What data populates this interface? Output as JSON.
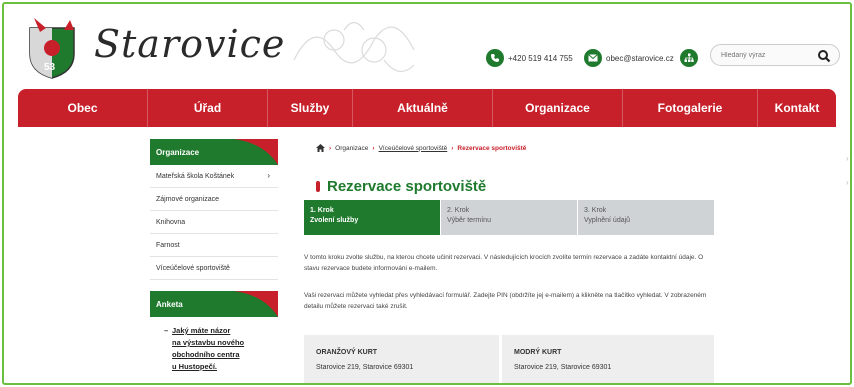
{
  "site": {
    "name": "Starovice"
  },
  "header": {
    "phone": "+420 519 414 755",
    "email": "obec@starovice.cz",
    "search_placeholder": "Hledaný výraz"
  },
  "nav": [
    "Obec",
    "Úřad",
    "Služby",
    "Aktuálně",
    "Organizace",
    "Fotogalerie",
    "Kontakt"
  ],
  "sidebar": {
    "section_title": "Organizace",
    "items": [
      {
        "label": "Mateřská škola Koštánek"
      },
      {
        "label": "Zájmové organizace"
      },
      {
        "label": "Knihovna"
      },
      {
        "label": "Farnost"
      },
      {
        "label": "Víceúčelové sportoviště"
      }
    ],
    "poll_title": "Anketa",
    "poll_question": [
      "Jaký máte názor",
      "na výstavbu nového",
      "obchodního centra",
      "u Hustopečí."
    ]
  },
  "breadcrumb": {
    "home": "home-icon",
    "items": [
      "Organizace",
      "Víceúčelové sportoviště"
    ],
    "current": "Rezervace sportoviště"
  },
  "page": {
    "title": "Rezervace sportoviště",
    "steps": [
      {
        "label": "1. Krok",
        "desc": "Zvolení služby",
        "active": true
      },
      {
        "label": "2. Krok",
        "desc": "Výběr termínu",
        "active": false
      },
      {
        "label": "3. Krok",
        "desc": "Vyplnění údajů",
        "active": false
      }
    ],
    "para1": "V tomto kroku zvolte službu, na kterou chcete učinit rezervaci. V následujících krocích zvolíte termín rezervace a zadáte kontaktní údaje. O stavu rezervace budete informováni e-mailem.",
    "para2": "Vaši rezervaci můžete vyhledat přes vyhledávací formulář. Zadejte PIN (obdržíte jej e-mailem) a klikněte na tlačítko vyhledat. V zobrazeném detailu můžete rezervaci také zrušit.",
    "cards": [
      {
        "name": "ORANŽOVÝ KURT",
        "address": "Starovice 219, Starovice 69301"
      },
      {
        "name": "MODRÝ KURT",
        "address": "Starovice 219, Starovice 69301"
      }
    ]
  },
  "colors": {
    "green": "#1f7a2e",
    "red": "#c8202a",
    "frame": "#6bbf3f"
  }
}
